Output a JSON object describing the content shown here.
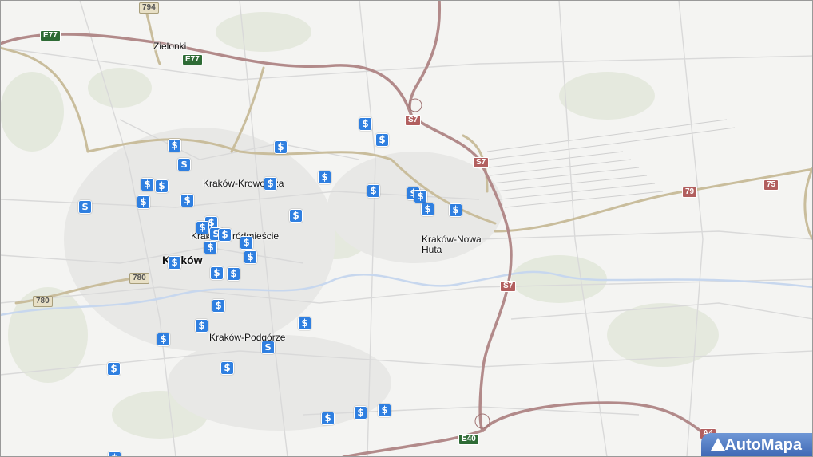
{
  "places": [
    {
      "name": "Zielonki",
      "big": false
    },
    {
      "name": "Kraków-Krowodrza",
      "big": false
    },
    {
      "name": "Kraków-Śródmieście",
      "big": false
    },
    {
      "name": "Kraków",
      "big": true
    },
    {
      "name": "Kraków-Podgórze",
      "big": false
    },
    {
      "name": "Kraków-Nowa Huta",
      "big": false
    }
  ],
  "road_shields": [
    {
      "label": "794",
      "kind": "beige"
    },
    {
      "label": "E77",
      "kind": "green"
    },
    {
      "label": "E77",
      "kind": "green"
    },
    {
      "label": "S7",
      "kind": "red"
    },
    {
      "label": "S7",
      "kind": "red"
    },
    {
      "label": "S7",
      "kind": "red"
    },
    {
      "label": "79",
      "kind": "red"
    },
    {
      "label": "75",
      "kind": "red"
    },
    {
      "label": "780",
      "kind": "beige"
    },
    {
      "label": "780",
      "kind": "beige"
    },
    {
      "label": "E40",
      "kind": "green"
    },
    {
      "label": "A4",
      "kind": "red"
    }
  ],
  "marker_symbol": "$",
  "marker_icon": "bank-dollar-icon",
  "marker_color": "#2f7fe0",
  "brand": {
    "name": "AutoMapa",
    "colors": [
      "#6f97d6",
      "#3e68b4"
    ]
  },
  "road_colors": {
    "motorway": "#b28a8a",
    "main": "#c9bd9c",
    "minor": "#dcdcdc",
    "river": "#c7d7ee"
  }
}
